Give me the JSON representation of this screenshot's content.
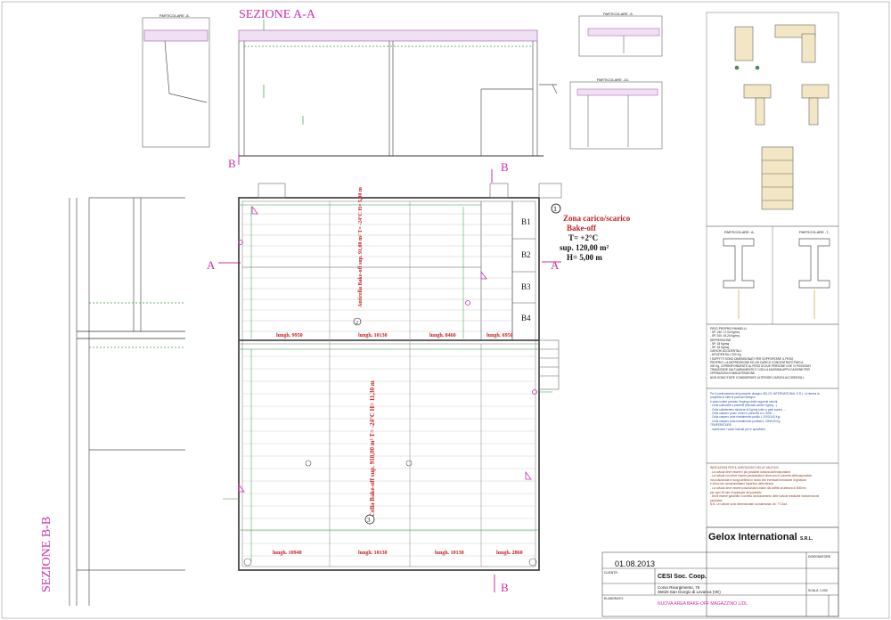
{
  "sections": {
    "section_aa_title": "SEZIONE A-A",
    "section_bb_title": "SEZIONE B-B",
    "cut_a": "A",
    "cut_b": "B"
  },
  "details": {
    "particolare_8": "PARTICOLARE -8-",
    "particolare_9": "PARTICOLARE -9-",
    "particolare_10": "PARTICOLARE -10-",
    "particolare_6": "PARTICOLARE -6-",
    "particolare_7": "PARTICOLARE -7-"
  },
  "zone1": {
    "number": "1",
    "name": "Zona carico/scarico",
    "subname": "Bake-off",
    "temp": "T= +2°C",
    "area": "sup. 120,00 m²",
    "height": "H= 5,00 m"
  },
  "zone2": {
    "number": "2",
    "label": "Anticella Bake-off sup. 91,00 m² T= -24°C H= 5,00 m"
  },
  "zone3": {
    "number": "3",
    "label": "Cella Bake-off sup. 918,00 m² T= -24°C H= 11,30 m"
  },
  "bays": [
    "B1",
    "B2",
    "B3",
    "B4"
  ],
  "lengths_upper": [
    "lungh. 9950",
    "lungh. 10130",
    "lungh. 8460",
    "lungh. 6950"
  ],
  "lengths_lower": [
    "lungh. 10940",
    "lungh. 10130",
    "lungh. 10130",
    "lungh. 2860"
  ],
  "notes": {
    "note1_lines": [
      "PESO PROPRIO PANNELLI:",
      "- SP. 150: 17,04 Kg/mq",
      "- SP. 200: 19,20 Kg/mq",
      "DEPRESSIONE:",
      "- SP. 18 Kg/mq",
      "- SP. 18 Kg/mq",
      "CARICHI ACCIDENTALI:",
      "- ACCIDENTALI: 200 Kg",
      "I SOFFITTI SONO DIMENSIONATI PER SOPPORTARE IL PESO",
      "PROPRIO, LA DEPRESSIONE ED UN CARICO CONCENTRATO PARI A",
      "200 Kg, CORRISPONDENTE AL PESO DI DUE PERSONE CHE VI POSSONO",
      "TRANSITARE SALTUARIAMENTE E CON LA MASSIMA APPLICAZIONE PER",
      "OPERAZIONI DI MANUTENZIONE.",
      "NON SONO STATE CONSIDERATE ULTERIORI CARICHI ACCIDENTALI."
    ],
    "note2_lines": [
      "Per il prelevamento del presente disegno GELOX INTERNATIONAL S.R.L. si riserva la",
      "proprietà di tutte le parti del disegno",
      "è stato inoltre previsto l'impiego delle seguenti carichi:",
      "- Cella sottocelle a pannelli (bloccati carichi Kg/mq...)",
      "- Cella sottoterreno strutture di Kg/mq (oltre a parti ponte) ...",
      "- Cella cassero posto a travi e pannello a n. 5000 ...",
      "- Cella cassero anta rivestimento profilo L 2000/140 Kg/..",
      "- Cella cassero anta rivestimento profilato L 2000/40 Kg",
      "TEMPERATURE",
      "- mantenere i valori indicati per le specifiche"
    ],
    "note3_lines": [
      "INDICAZIONI PER IL MONTAGGIO DELLE VALVOLE:",
      "- La valvola deve essere il più possibile lontana dall'evaporatore.",
      "- La valvola non deve essere posizionata in linea con la corrente dell'evaporatore",
      "  ma posizionata in luogo definito in modo che eventuali formazioni di ghiaccio",
      "  e brina non compromettano l'apertura della stessa.",
      "- La valvola deve essere posizionata lontano dai soffitti ad altezza di 800mm",
      "  per ogni 18 mm di spessore del pannello.",
      "- Deve essere garantito il corretto funzionamento delle valvole mediante manutenzione",
      "  periodica.",
      "N.B. Le valvole sono dimensionate considerando dt= 7°C/ora"
    ]
  },
  "title_block": {
    "company": "Gelox International",
    "company_suffix": "S.R.L.",
    "date": "01.08.2013",
    "client_label": "CLIENTE:",
    "client": "CESI Soc. Coop.",
    "address_line1": "Corso Risorgimento, 76",
    "address_line2": "36020 San Giorgio di Levanca (VE)",
    "project_label": "ELABORATO:",
    "project": "NUOVA AREA BAKE-OFF MAGAZZINO LIDL",
    "scale_label": "SCALA",
    "scale": "1:200",
    "drawn_label": "DISEGNATORE"
  },
  "colors": {
    "magenta": "#cc2fa6",
    "red": "#c81e1e",
    "green": "#2e9a3a",
    "grey": "#7a7a7a"
  }
}
